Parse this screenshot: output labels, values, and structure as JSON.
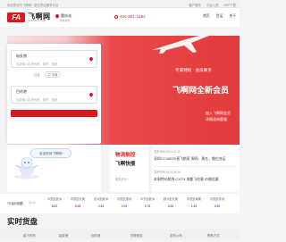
{
  "topbar": {
    "tagline": "欢迎您访问飞啊网 · 航空货运服务平台",
    "links": [
      "客户服务",
      "平台入驻",
      "APP下载"
    ]
  },
  "header": {
    "logo": "FA",
    "brand": "飞啊网",
    "brand_sub": "FEIAWANG.COM",
    "city": "重庆站",
    "city_sub": "切换城市",
    "phone": "400-881-1192",
    "nav": [
      "首页",
      "货运",
      "关于"
    ]
  },
  "hero": {
    "kicker": "专属特权 · 会员尊享",
    "headline": "飞啊网全新会员",
    "line1": "加入飞啊网会员",
    "line2": "详情咨询客服"
  },
  "search": {
    "from_label": "始发港",
    "from_placeholder": "支持输入机场代码、城市、国家",
    "swap_prefix": "往返",
    "swap_label": "⇄ 中转",
    "to_label": "目的港",
    "to_placeholder": "支持输入机场代码、城市、国家"
  },
  "mini_promo": {
    "label": "欢迎来到飞啊网~"
  },
  "feature": {
    "t1": "物流航控",
    "t2": "飞啊快报",
    "t3": "更多资讯 >"
  },
  "news": [
    {
      "date": "发布时间 2023-04-11",
      "headline": "深圳CZ-MD3X直飞航班 周四、周五，舱位充足"
    },
    {
      "date": "发布时间 2023-04-06",
      "headline": "本周特价航线 CX/T4 成都飞伦敦 价格优惠"
    }
  ],
  "stats": {
    "title": "TK运价指数",
    "date": "04-11",
    "items": [
      {
        "label": "中国至欧洲",
        "value": "8.62"
      },
      {
        "label": "中国至北美",
        "value": "0.15"
      },
      {
        "label": "亚洲至欧洲",
        "value": "2.34"
      },
      {
        "label": "中国至澳洲",
        "value": "1.09"
      },
      {
        "label": "中东至欧洲",
        "value": "0.78"
      },
      {
        "label": "欧洲至北美",
        "value": "3.26"
      },
      {
        "label": "中国至南美",
        "value": "1.43"
      },
      {
        "label": "中国至非洲",
        "value": "0.52"
      }
    ]
  },
  "cargo": {
    "title": "实时货盘",
    "columns": [
      "起飞时间",
      "始发港",
      "目的港",
      "货物信息",
      "发布公司",
      "联系方式"
    ]
  },
  "colors": {
    "brand_red": "#d71920",
    "accent_blue": "#2b6fd6"
  }
}
